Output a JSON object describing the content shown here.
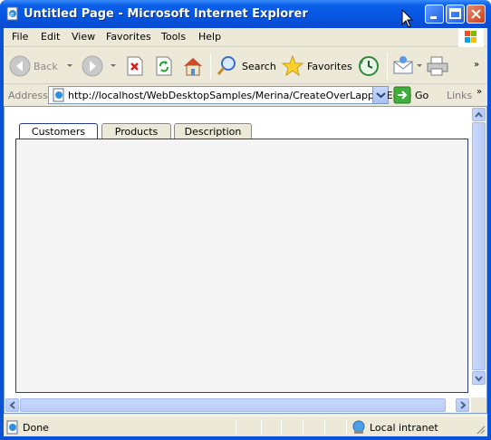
{
  "window": {
    "title": "Untitled Page - Microsoft Internet Explorer",
    "title_bar_color": "#0a55e0",
    "close_button_color": "#c8401c"
  },
  "menu": {
    "items": [
      "File",
      "Edit",
      "View",
      "Favorites",
      "Tools",
      "Help"
    ]
  },
  "toolbar": {
    "back_label": "Back",
    "search_label": "Search",
    "favorites_label": "Favorites",
    "icons": [
      "back-icon",
      "forward-icon",
      "stop-icon",
      "refresh-icon",
      "home-icon",
      "search-icon",
      "favorites-icon",
      "history-icon",
      "mail-icon",
      "print-icon"
    ]
  },
  "address": {
    "label": "Address",
    "url": "http://localhost/WebDesktopSamples/Merina/CreateOverLappedEdge",
    "go_label": "Go",
    "links_label": "Links"
  },
  "page": {
    "tabs": [
      {
        "label": "Customers",
        "active": true
      },
      {
        "label": "Products",
        "active": false
      },
      {
        "label": "Description",
        "active": false
      }
    ],
    "panel_background": "#f4f4f4",
    "border_color": "#2a3b8f"
  },
  "status": {
    "text": "Done",
    "zone": "Local intranet"
  },
  "colors": {
    "chrome": "#ece9d8",
    "scrollbar": "#b9cbf7"
  }
}
